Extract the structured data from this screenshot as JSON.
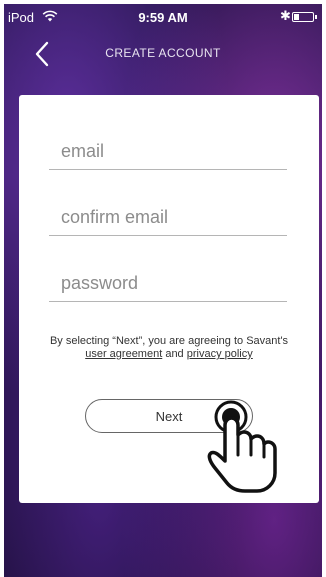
{
  "status_bar": {
    "carrier": "iPod",
    "time": "9:59 AM",
    "battery_level": 0.3
  },
  "nav": {
    "title": "CREATE ACCOUNT"
  },
  "form": {
    "email_placeholder": "email",
    "confirm_email_placeholder": "confirm email",
    "password_placeholder": "password",
    "email_value": "",
    "confirm_email_value": "",
    "password_value": "",
    "legal_prefix": "By selecting “Next”, you are agreeing to Savant's ",
    "user_agreement_link": "user agreement",
    "legal_and": " and ",
    "privacy_policy_link": "privacy policy",
    "next_label": "Next"
  },
  "icons": {
    "back": "chevron-left-icon",
    "wifi": "wifi-icon",
    "bluetooth": "bluetooth-icon",
    "battery": "battery-icon",
    "pointer": "hand-pointer-icon"
  },
  "colors": {
    "background_top": "#25154a",
    "background_bottom": "#1c0f38",
    "card": "#ffffff",
    "text": "#333333"
  }
}
